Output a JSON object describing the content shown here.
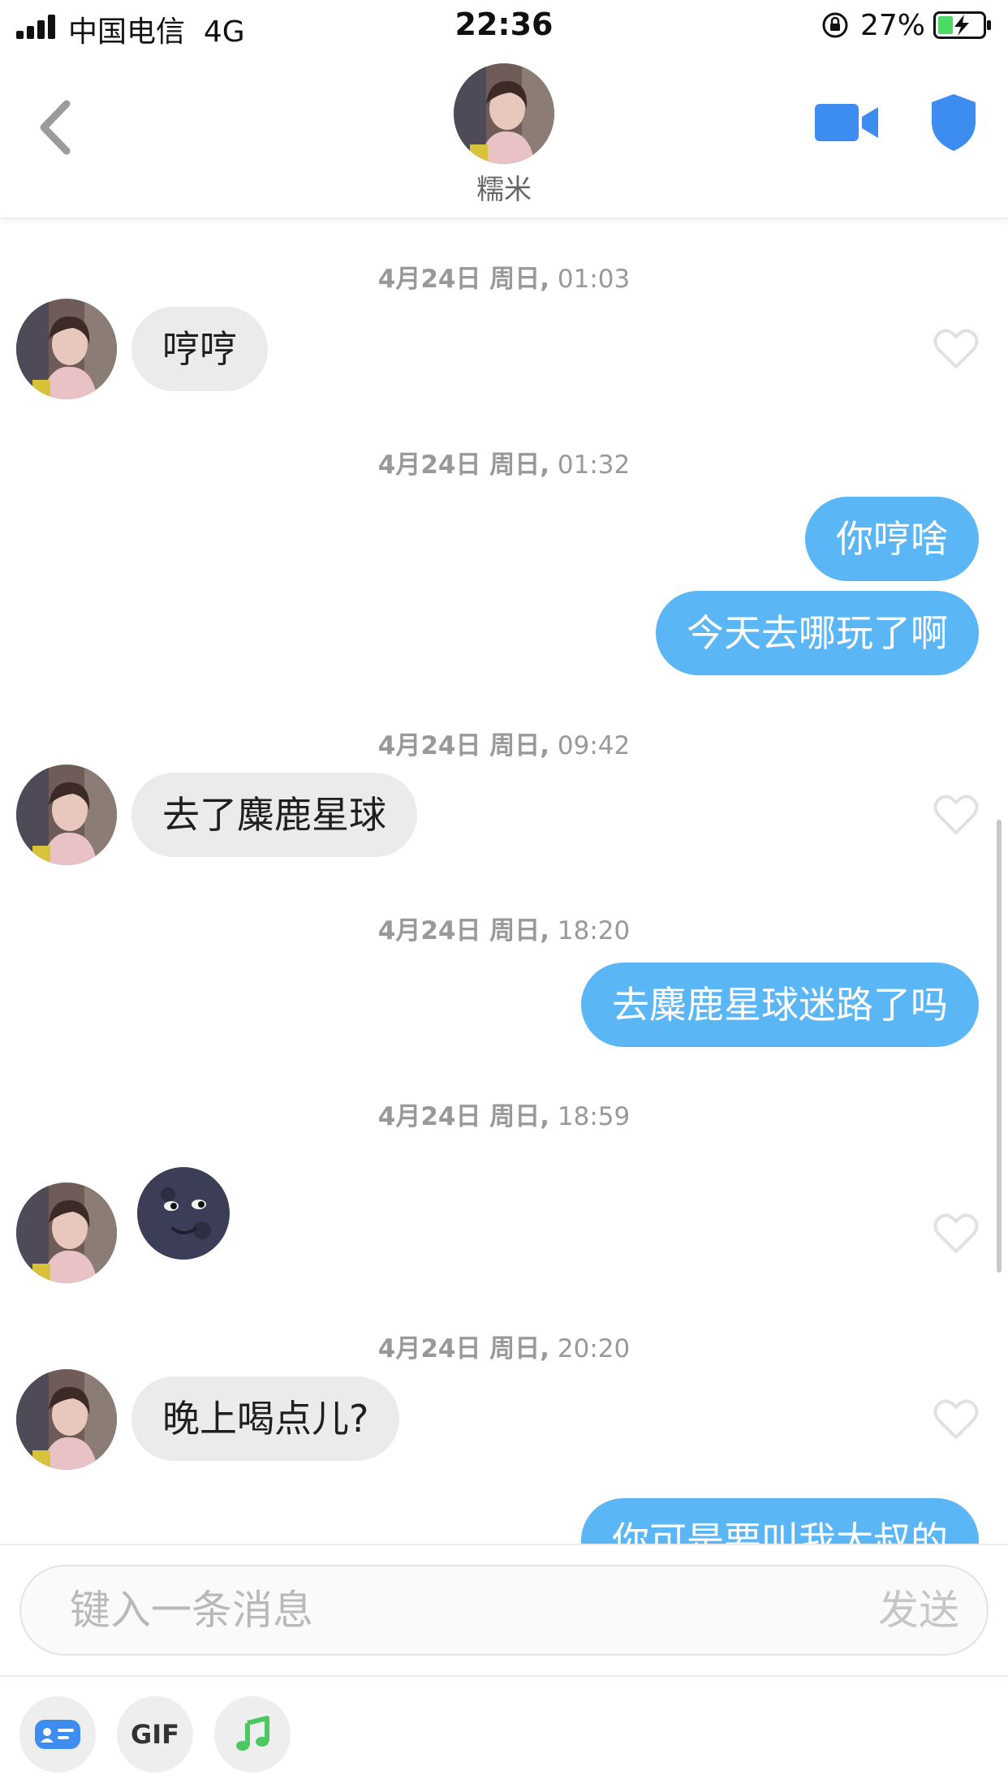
{
  "status_bar": {
    "carrier": "中国电信",
    "network": "4G",
    "time": "22:36",
    "battery": "27%",
    "signal_icon": "signal-bars-icon",
    "lock_icon": "orientation-lock-icon",
    "battery_icon": "battery-charging-icon"
  },
  "header": {
    "contact_name": "糯米",
    "back_icon": "chevron-left-icon",
    "video_icon": "video-camera-icon",
    "shield_icon": "shield-icon",
    "accent_color": "#3d8df0"
  },
  "messages": [
    {
      "timestamp_day": "4月24日 周日,",
      "timestamp_time": "01:03"
    },
    {
      "side": "in",
      "text": "哼哼"
    },
    {
      "timestamp_day": "4月24日 周日,",
      "timestamp_time": "01:32"
    },
    {
      "side": "out",
      "text": "你哼啥"
    },
    {
      "side": "out",
      "text": "今天去哪玩了啊"
    },
    {
      "timestamp_day": "4月24日 周日,",
      "timestamp_time": "09:42"
    },
    {
      "side": "in",
      "text": "去了麋鹿星球"
    },
    {
      "timestamp_day": "4月24日 周日,",
      "timestamp_time": "18:20"
    },
    {
      "side": "out",
      "text": "去麋鹿星球迷路了吗"
    },
    {
      "timestamp_day": "4月24日 周日,",
      "timestamp_time": "18:59"
    },
    {
      "side": "in",
      "emoji": "new-moon-face-emoji"
    },
    {
      "timestamp_day": "4月24日 周日,",
      "timestamp_time": "20:20"
    },
    {
      "side": "in",
      "text": "晚上喝点儿?"
    },
    {
      "side": "out",
      "text": "你可是要叫我大叔的"
    }
  ],
  "input": {
    "placeholder": "键入一条消息",
    "send_label": "发送"
  },
  "toolbar": {
    "card_icon": "contact-card-icon",
    "gif_label": "GIF",
    "music_icon": "music-note-icon"
  },
  "colors": {
    "outgoing_bubble": "#5bb6f5",
    "incoming_bubble": "#ebebeb",
    "timestamp": "#999999"
  }
}
